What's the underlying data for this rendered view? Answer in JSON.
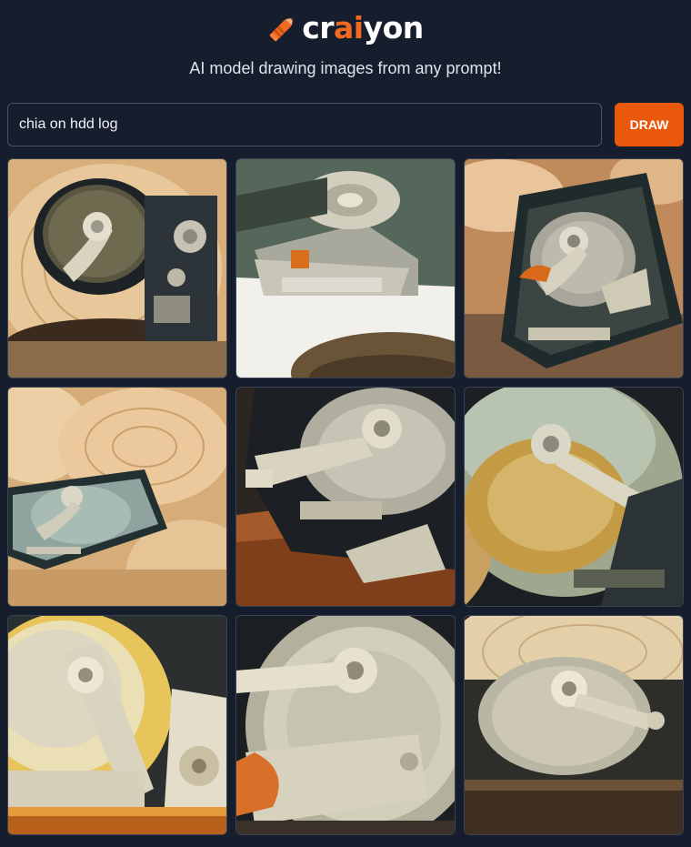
{
  "logo": {
    "text_before": "cr",
    "text_accent": "ai",
    "text_after": "yon",
    "icon": "pencil-icon",
    "accent_color": "#f26a21"
  },
  "tagline": "AI model drawing images from any prompt!",
  "prompt": {
    "value": "chia on hdd log"
  },
  "draw_button": {
    "label": "DRAW",
    "color": "#ea580c"
  },
  "results": {
    "count": 9,
    "images": [
      "hard drive on wooden log",
      "hard drive over pile of seeds",
      "hard drive on wooden logs",
      "hard drive on log slices",
      "hard drive on wooden surface",
      "hard drive on wood",
      "hard drive closeup with gold platter",
      "hard drive closeup",
      "hard drive in front of log"
    ]
  }
}
